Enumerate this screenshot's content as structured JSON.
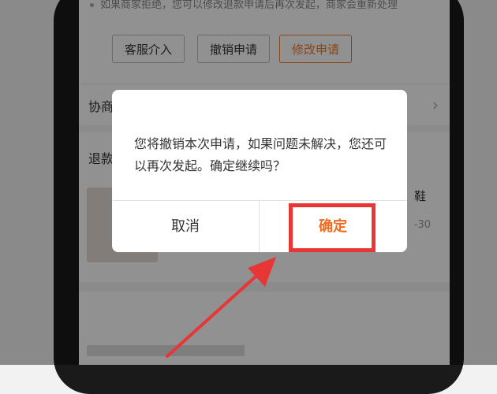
{
  "background_app": {
    "notice_text": "如果商家拒绝，您可以修改退款申请后再次发起，商家会重新处理",
    "buttons": {
      "service": "客服介入",
      "revoke": "撤销申请",
      "modify": "修改申请"
    },
    "negotiation_label": "协商",
    "refund_label": "退款",
    "product_title_fragment": "鞋",
    "product_meta_fragment": "-30"
  },
  "dialog": {
    "message": "您将撤销本次申请，如果问题未解决，您还可以再次发起。确定继续吗？",
    "cancel_label": "取消",
    "confirm_label": "确定"
  },
  "colors": {
    "accent": "#f06a20",
    "highlight": "#e83535",
    "overlay": "rgba(0,0,0,0.43)"
  }
}
